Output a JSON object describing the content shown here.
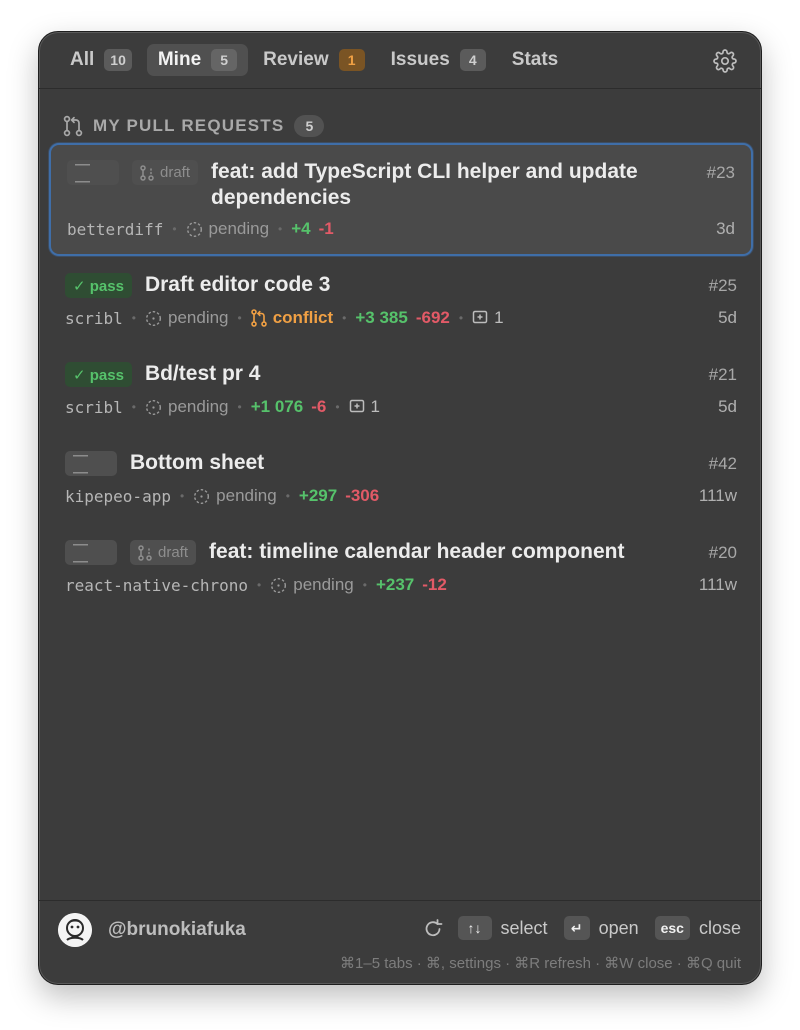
{
  "tabs": [
    {
      "label": "All",
      "count": "10"
    },
    {
      "label": "Mine",
      "count": "5"
    },
    {
      "label": "Review",
      "count": "1"
    },
    {
      "label": "Issues",
      "count": "4"
    },
    {
      "label": "Stats"
    }
  ],
  "active_tab": "Mine",
  "section": {
    "title": "MY PULL REQUESTS",
    "count": "5"
  },
  "prs": [
    {
      "check": "— —",
      "draft_label": "draft",
      "title_line1": "feat: add TypeScript CLI helper and update",
      "title_line2": "dependencies",
      "number": "#23",
      "repo": "betterdiff",
      "status": "pending",
      "additions": "+4",
      "deletions": "-1",
      "age": "3d"
    },
    {
      "check": "✓ pass",
      "title": "Draft editor code 3",
      "number": "#25",
      "repo": "scribl",
      "status": "pending",
      "conflict": "conflict",
      "additions": "+3 385",
      "deletions": "-692",
      "comments": "1",
      "age": "5d"
    },
    {
      "check": "✓ pass",
      "title": "Bd/test pr 4",
      "number": "#21",
      "repo": "scribl",
      "status": "pending",
      "additions": "+1 076",
      "deletions": "-6",
      "comments": "1",
      "age": "5d"
    },
    {
      "check": "— —",
      "title": "Bottom sheet",
      "number": "#42",
      "repo": "kipepeo-app",
      "status": "pending",
      "additions": "+297",
      "deletions": "-306",
      "age": "111w"
    },
    {
      "check": "— —",
      "draft_label": "draft",
      "title": "feat: timeline calendar header component",
      "number": "#20",
      "repo": "react-native-chrono",
      "status": "pending",
      "additions": "+237",
      "deletions": "-12",
      "age": "111w"
    }
  ],
  "footer": {
    "username": "@brunokiafuka",
    "select_key": "↑↓",
    "select_label": "select",
    "open_key": "↵",
    "open_label": "open",
    "close_key": "esc",
    "close_label": "close",
    "shortcuts": "⌘1–5 tabs · ⌘, settings · ⌘R refresh · ⌘W close · ⌘Q quit"
  },
  "colors": {
    "accent_blue": "#3f6ea8",
    "pass_green": "#56c26b",
    "deletion_red": "#e25a67",
    "conflict_orange": "#f0a044",
    "background": "#3c3c3c"
  }
}
